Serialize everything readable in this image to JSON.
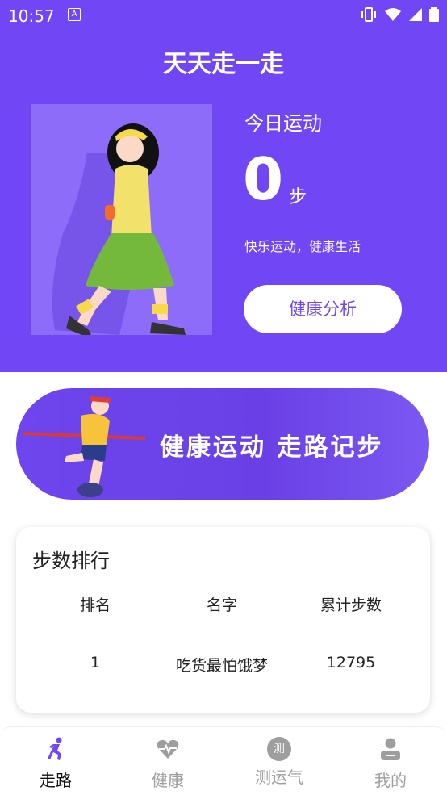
{
  "status": {
    "time": "10:57",
    "a_icon": "A"
  },
  "header": {
    "title": "天天走一走",
    "today_label": "今日运动",
    "step_count": "0",
    "step_unit": "步",
    "slogan": "快乐运动，健康生活",
    "analysis_button": "健康分析"
  },
  "banner": {
    "text": "健康运动 走路记步"
  },
  "ranking": {
    "title": "步数排行",
    "columns": [
      "排名",
      "名字",
      "累计步数"
    ],
    "rows": [
      {
        "rank": "1",
        "name": "吃货最怕饿梦",
        "steps": "12795"
      }
    ]
  },
  "tabbar": {
    "items": [
      {
        "label": "走路",
        "icon": "running-icon",
        "active": true
      },
      {
        "label": "健康",
        "icon": "heartbeat-icon",
        "active": false
      },
      {
        "label": "测运气",
        "icon": "test-icon",
        "active": false
      },
      {
        "label": "我的",
        "icon": "profile-icon",
        "active": false
      }
    ],
    "test_icon_glyph": "测"
  },
  "colors": {
    "primary": "#7046f5",
    "active_tab": "#111111",
    "inactive_tab": "#9e9e9e"
  }
}
